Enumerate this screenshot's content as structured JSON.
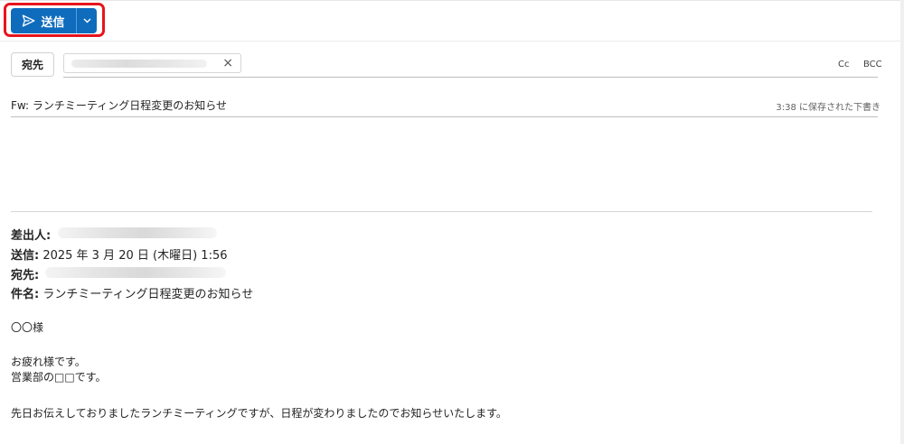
{
  "toolbar": {
    "send_label": "送信",
    "highlight_color": "#e8141c",
    "primary_color": "#0f6cbd",
    "send_icon": "send-icon",
    "dropdown_icon": "chevron-down-icon"
  },
  "recipients": {
    "to_label": "宛先",
    "remove_icon": "×",
    "cc_label": "Cc",
    "bcc_label": "BCC"
  },
  "subject": {
    "text": "Fw: ランチミーティング日程変更のお知らせ",
    "draft_status": "3:38 に保存された下書き"
  },
  "forwarded": {
    "from_label": "差出人:",
    "sent_label": "送信:",
    "sent_value": " 2025 年 3 月 20 日 (木曜日) 1:56",
    "to_label": "宛先:",
    "subject_label": "件名:",
    "subject_value": " ランチミーティング日程変更のお知らせ"
  },
  "body": {
    "greeting": "〇〇様",
    "line1": "お疲れ様です。",
    "line2": "営業部の□□です。",
    "line3": "先日お伝えしておりましたランチミーティングですが、日程が変わりましたのでお知らせいたします。"
  }
}
